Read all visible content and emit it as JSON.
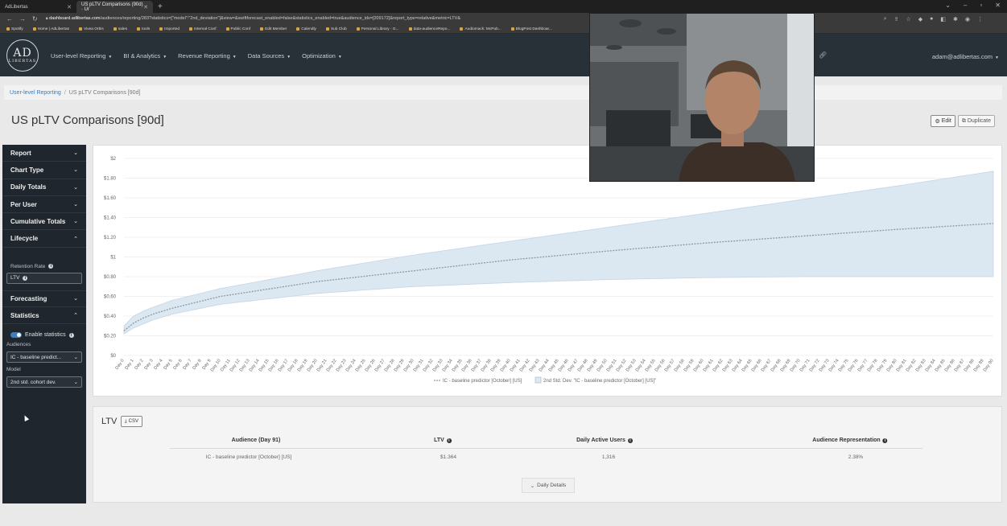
{
  "browser": {
    "tabs": [
      {
        "label": "AdLibertas",
        "active": false
      },
      {
        "label": "US pLTV Comparisons (90d) · Ur",
        "active": true
      }
    ],
    "url_host": "dashboard.adlibertas.com",
    "url_path": "/audiences/reporting/283?statistics=[\"model\":\"2nd_deviation\"]&view=&swiftforecast_enabled=false&statistics_enabled=true&audience_ids=[209172]&report_type=relative&metric=LTV&",
    "bookmarks": [
      "Spotify",
      "Home | AdLibertas",
      "Vivea Orbis",
      "sales",
      "tools",
      "Imported",
      "Internal Conf",
      "Public Conf",
      "Edit Member",
      "Calendly",
      "Sub Club",
      "Personal Library - G...",
      "data-audienceRepo...",
      "Audiomack: McPub...",
      "BlogPost Dashboar..."
    ]
  },
  "nav": {
    "logo_big": "AD",
    "logo_small": "LIBERTAS",
    "menu": [
      "User-level Reporting",
      "BI & Analytics",
      "Revenue Reporting",
      "Data Sources",
      "Optimization"
    ],
    "user": "adam@adlibertas.com"
  },
  "breadcrumb": {
    "parent": "User-level Reporting",
    "current": "US pLTV Comparisons [90d]"
  },
  "page": {
    "title": "US pLTV Comparisons [90d]",
    "edit_label": "Edit",
    "duplicate_label": "Duplicate"
  },
  "sidebar": {
    "sections": [
      "Report",
      "Chart Type",
      "Daily Totals",
      "Per User",
      "Cumulative Totals",
      "Lifecycle"
    ],
    "retention_label": "Retention Rate",
    "ltv_value": "LTV",
    "forecasting": "Forecasting",
    "statistics": "Statistics",
    "enable_stats": "Enable statistics",
    "audiences_label": "Audiences",
    "audience_value": "IC - baseline predict...",
    "model_label": "Model",
    "model_value": "2nd std. cohort dev."
  },
  "chart_data": {
    "type": "line",
    "x_start_day": 0,
    "x_end_day": 90,
    "x_tick_prefix": "Day",
    "y_ticks": [
      "$0",
      "$0.20",
      "$0.40",
      "$0.60",
      "$0.80",
      "$1",
      "$1.20",
      "$1.40",
      "$1.60",
      "$1.80",
      "$2"
    ],
    "ylim": [
      0,
      2
    ],
    "series": [
      {
        "name": "IC - baseline predictor [October] [US]",
        "style": "dashed-line",
        "color": "#8a9aa6",
        "x": [
          0,
          1,
          2,
          3,
          5,
          10,
          20,
          30,
          40,
          50,
          60,
          70,
          80,
          90
        ],
        "values": [
          0.25,
          0.33,
          0.38,
          0.42,
          0.48,
          0.6,
          0.75,
          0.86,
          0.97,
          1.06,
          1.14,
          1.21,
          1.28,
          1.34
        ]
      },
      {
        "name": "2nd Std. Dev. \"IC - baseline predictor [October] [US]\"",
        "style": "band",
        "color": "#dbe7f1",
        "x": [
          0,
          1,
          2,
          3,
          5,
          10,
          20,
          30,
          40,
          50,
          60,
          70,
          80,
          90
        ],
        "upper": [
          0.3,
          0.4,
          0.45,
          0.49,
          0.56,
          0.68,
          0.86,
          1.02,
          1.16,
          1.3,
          1.44,
          1.58,
          1.72,
          1.87
        ],
        "lower": [
          0.22,
          0.28,
          0.32,
          0.36,
          0.42,
          0.52,
          0.63,
          0.7,
          0.74,
          0.77,
          0.79,
          0.8,
          0.8,
          0.8
        ]
      }
    ],
    "legend_position": "bottom"
  },
  "ltv_table": {
    "title": "LTV",
    "csv_label": "CSV",
    "headers": [
      "Audience (Day 91)",
      "LTV",
      "Daily Active Users",
      "Audience Representation"
    ],
    "rows": [
      [
        "IC - baseline predictor [October] [US]",
        "$1.364",
        "1,316",
        "2.38%"
      ]
    ],
    "daily_details": "Daily Details"
  }
}
